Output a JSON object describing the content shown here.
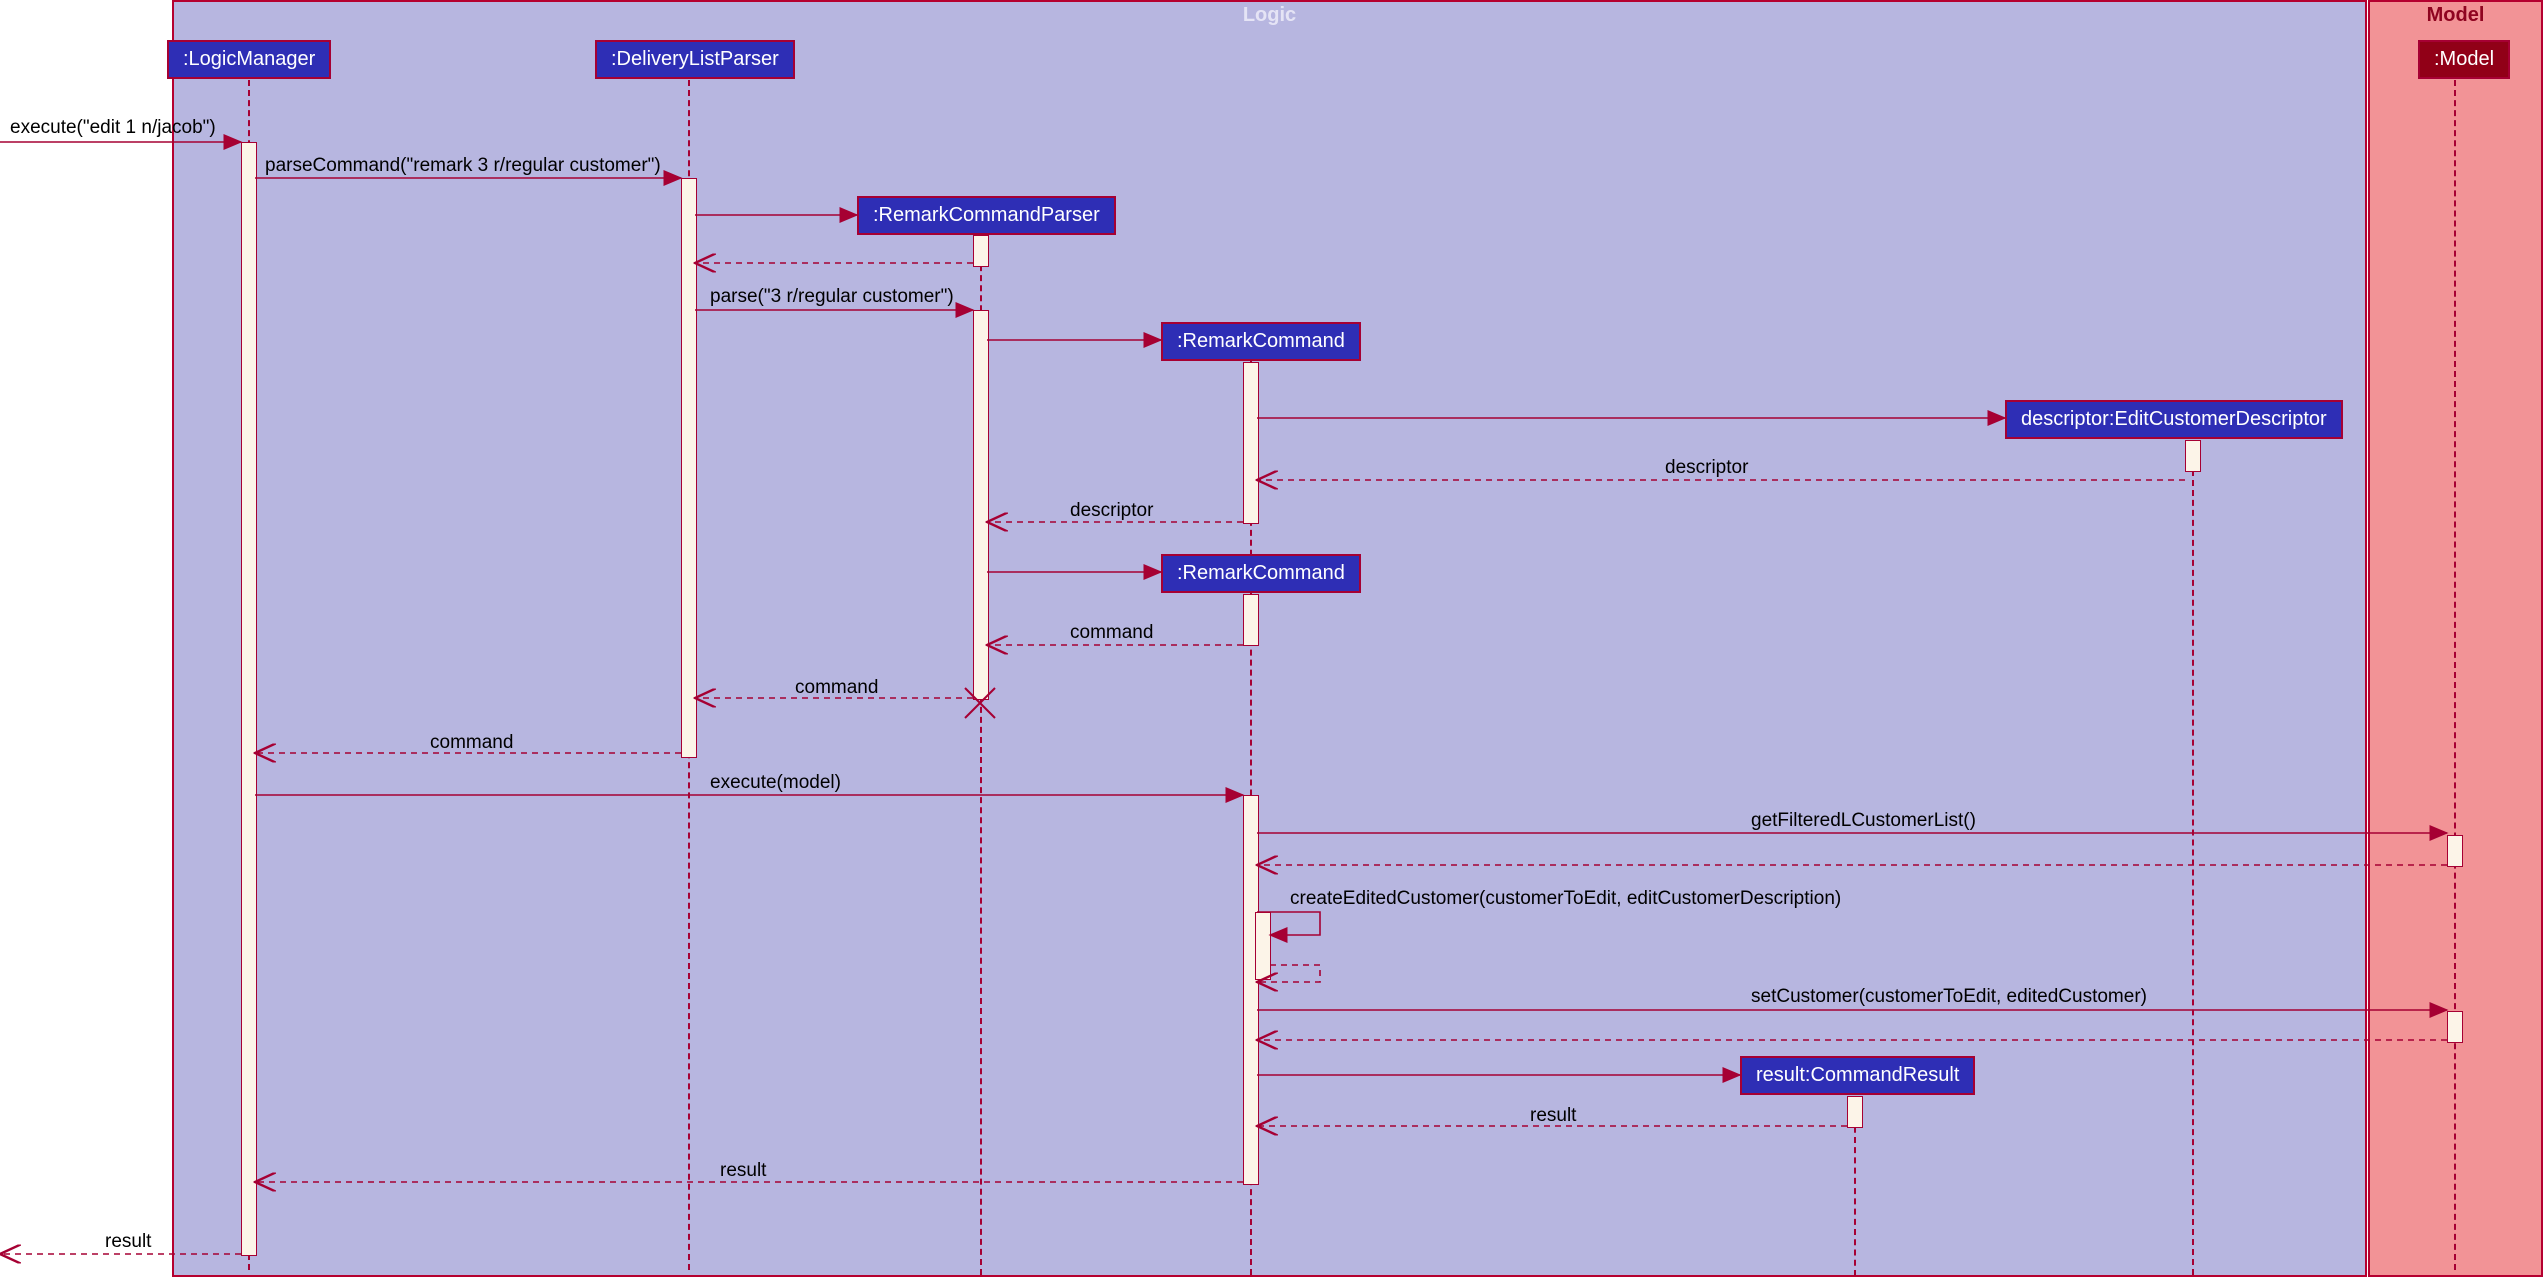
{
  "frames": {
    "logic": "Logic",
    "model": "Model"
  },
  "participants": {
    "logicManager": ":LogicManager",
    "deliveryListParser": ":DeliveryListParser",
    "remarkCommandParser": ":RemarkCommandParser",
    "remarkCommand1": ":RemarkCommand",
    "editCustomerDescriptor": "descriptor:EditCustomerDescriptor",
    "remarkCommand2": ":RemarkCommand",
    "commandResult": "result:CommandResult",
    "model": ":Model"
  },
  "messages": {
    "executeEdit": "execute(\"edit 1 n/jacob\")",
    "parseCommand": "parseCommand(\"remark 3 r/regular customer\")",
    "parse": "parse(\"3 r/regular customer\")",
    "descriptor1": "descriptor",
    "descriptor2": "descriptor",
    "command1": "command",
    "command2": "command",
    "command3": "command",
    "executeModel": "execute(model)",
    "getFilteredCustomerList": "getFilteredLCustomerList()",
    "createEditedCustomer": "createEditedCustomer(customerToEdit, editCustomerDescription)",
    "setCustomer": "setCustomer(customerToEdit, editedCustomer)",
    "result1": "result",
    "result2": "result",
    "result3": "result"
  }
}
